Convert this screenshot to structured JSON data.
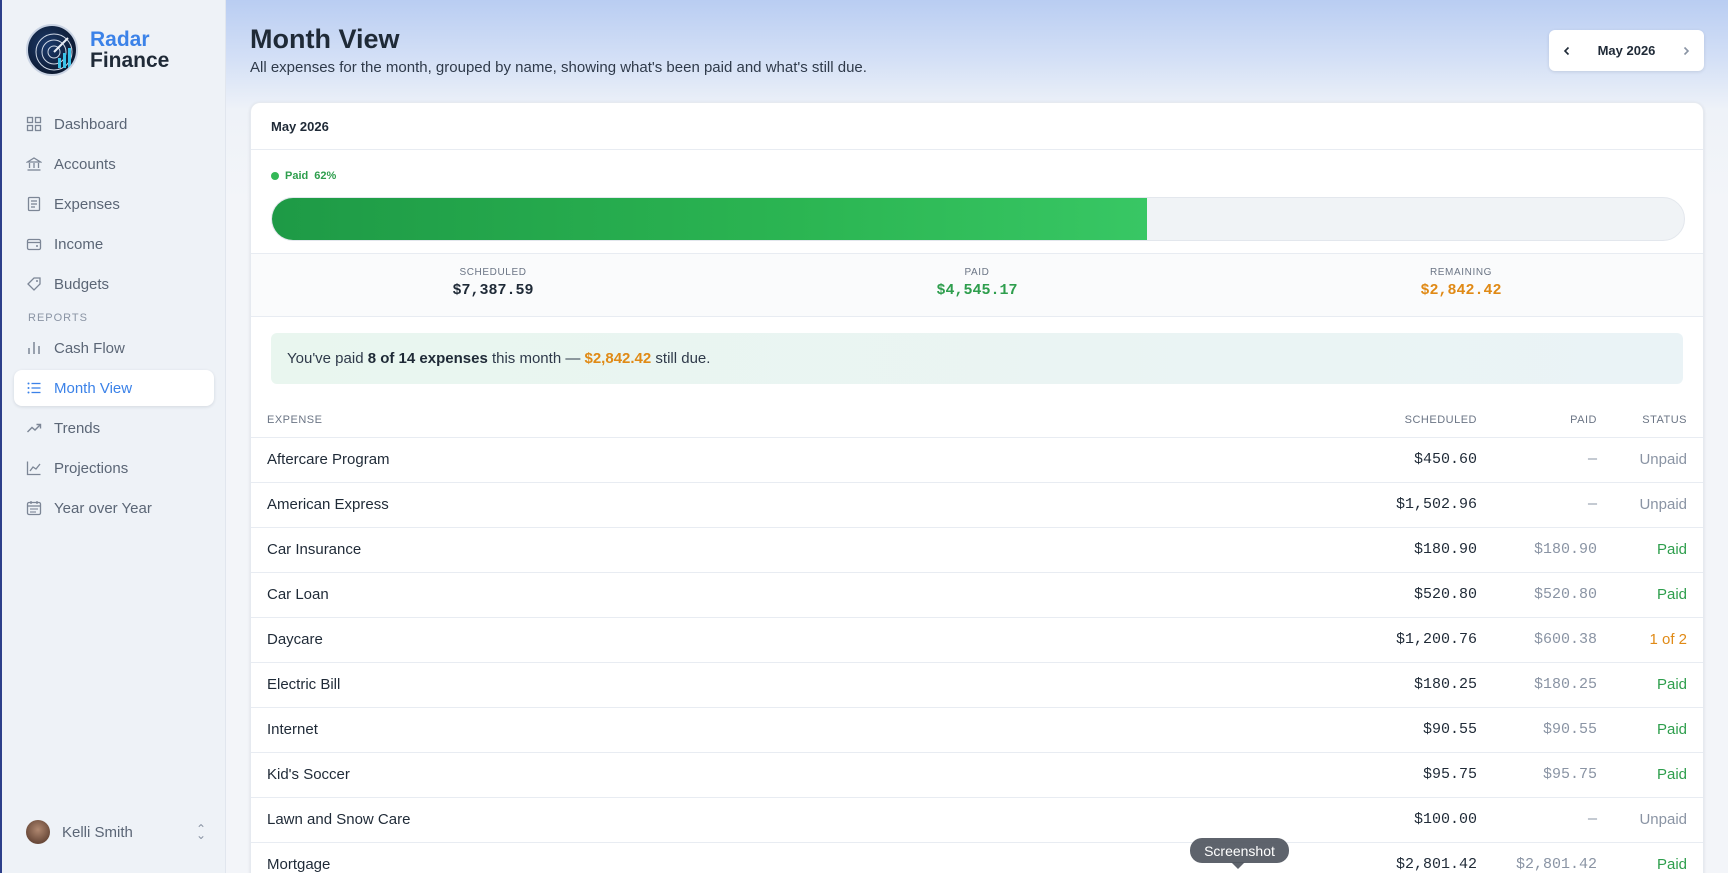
{
  "brand": {
    "name_line1": "Radar",
    "name_line2": "Finance"
  },
  "sidebar": {
    "items": [
      {
        "label": "Dashboard"
      },
      {
        "label": "Accounts"
      },
      {
        "label": "Expenses"
      },
      {
        "label": "Income"
      },
      {
        "label": "Budgets"
      }
    ],
    "reports_heading": "REPORTS",
    "reports": [
      {
        "label": "Cash Flow"
      },
      {
        "label": "Month View",
        "active": true
      },
      {
        "label": "Trends"
      },
      {
        "label": "Projections"
      },
      {
        "label": "Year over Year"
      }
    ],
    "user": {
      "name": "Kelli Smith"
    }
  },
  "header": {
    "title": "Month View",
    "subtitle": "All expenses for the month, grouped by name, showing what's been paid and what's still due.",
    "month_picker": "May 2026"
  },
  "card": {
    "title": "May 2026",
    "progress": {
      "label": "Paid",
      "percent_text": "62%",
      "fraction": 0.62
    },
    "summary": {
      "scheduled_label": "SCHEDULED",
      "scheduled": "$7,387.59",
      "paid_label": "PAID",
      "paid": "$4,545.17",
      "remaining_label": "REMAINING",
      "remaining": "$2,842.42"
    },
    "notice": {
      "prefix": "You've paid ",
      "count": "8 of 14 expenses",
      "middle": " this month — ",
      "amount": "$2,842.42",
      "suffix": " still due."
    },
    "table": {
      "headers": {
        "expense": "EXPENSE",
        "scheduled": "SCHEDULED",
        "paid": "PAID",
        "status": "STATUS"
      },
      "rows": [
        {
          "name": "Aftercare Program",
          "scheduled": "$450.60",
          "paid": "—",
          "status": "Unpaid",
          "kind": "unpaid"
        },
        {
          "name": "American Express",
          "scheduled": "$1,502.96",
          "paid": "—",
          "status": "Unpaid",
          "kind": "unpaid"
        },
        {
          "name": "Car Insurance",
          "scheduled": "$180.90",
          "paid": "$180.90",
          "status": "Paid",
          "kind": "paid"
        },
        {
          "name": "Car Loan",
          "scheduled": "$520.80",
          "paid": "$520.80",
          "status": "Paid",
          "kind": "paid"
        },
        {
          "name": "Daycare",
          "scheduled": "$1,200.76",
          "paid": "$600.38",
          "status": "1 of 2",
          "kind": "partial"
        },
        {
          "name": "Electric Bill",
          "scheduled": "$180.25",
          "paid": "$180.25",
          "status": "Paid",
          "kind": "paid"
        },
        {
          "name": "Internet",
          "scheduled": "$90.55",
          "paid": "$90.55",
          "status": "Paid",
          "kind": "paid"
        },
        {
          "name": "Kid's Soccer",
          "scheduled": "$95.75",
          "paid": "$95.75",
          "status": "Paid",
          "kind": "paid"
        },
        {
          "name": "Lawn and Snow Care",
          "scheduled": "$100.00",
          "paid": "—",
          "status": "Unpaid",
          "kind": "unpaid"
        },
        {
          "name": "Mortgage",
          "scheduled": "$2,801.42",
          "paid": "$2,801.42",
          "status": "Paid",
          "kind": "paid"
        }
      ]
    }
  },
  "tooltip": "Screenshot",
  "colors": {
    "accent": "#3b82e8",
    "paid": "#2e9e4d",
    "remaining": "#e08a16"
  },
  "icons": {
    "nav": [
      "dashboard-icon",
      "accounts-icon",
      "expenses-icon",
      "income-icon",
      "budgets-icon"
    ],
    "reports": [
      "cash-flow-icon",
      "month-view-icon",
      "trends-icon",
      "projections-icon",
      "year-over-year-icon"
    ]
  }
}
